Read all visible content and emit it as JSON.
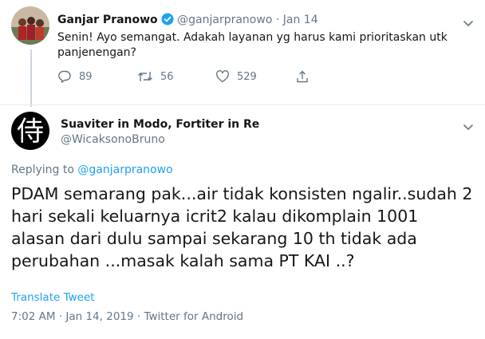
{
  "colors": {
    "accent": "#1da1f2",
    "muted": "#657786",
    "text": "#14171a",
    "thread_line": "#ccd6dd"
  },
  "tweet1": {
    "author_name": "Ganjar Pranowo",
    "verified_icon": "verified-badge-icon",
    "handle": "@ganjarpranowo",
    "separator": "·",
    "date": "Jan 14",
    "text": "Senin! Ayo semangat. Adakah layanan yg harus kami prioritaskan utk panjenengan?",
    "actions": {
      "reply_icon": "reply-icon",
      "reply_count": "89",
      "retweet_icon": "retweet-icon",
      "retweet_count": "56",
      "like_icon": "heart-icon",
      "like_count": "529",
      "share_icon": "share-icon"
    },
    "menu_icon": "chevron-down-icon"
  },
  "tweet2": {
    "author_name": "Suaviter in Modo, Fortiter in Re",
    "handle": "@WicaksonoBruno",
    "avatar_glyph": "侍",
    "replying_label": "Replying to",
    "replying_to": "@ganjarpranowo",
    "text": "PDAM semarang pak...air tidak konsisten ngalir..sudah 2 hari sekali keluarnya icrit2 kalau dikomplain 1001 alasan dari dulu sampai sekarang 10 th tidak ada perubahan ...masak kalah sama PT KAI ..?",
    "translate_label": "Translate Tweet",
    "timestamp": "7:02 AM · Jan 14, 2019 · Twitter for Android",
    "menu_icon": "chevron-down-icon"
  }
}
